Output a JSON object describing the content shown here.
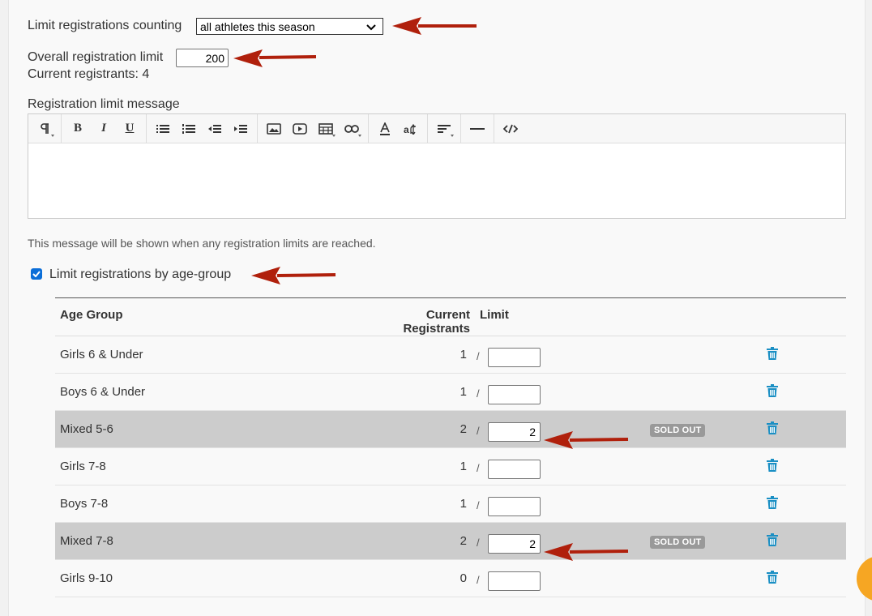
{
  "form": {
    "counting_label": "Limit registrations counting",
    "counting_value": "all athletes this season",
    "overall_label": "Overall registration limit",
    "overall_value": "200",
    "current_registrants": "Current registrants: 4",
    "message_label": "Registration limit message",
    "message_help": "This message will be shown when any registration limits are reached.",
    "agegroup_checkbox_label": "Limit registrations by age-group",
    "agegroup_checked": true
  },
  "editor": {
    "toolbar_icons": [
      "paragraph-format-icon",
      "bold-icon",
      "italic-icon",
      "underline-icon",
      "unordered-list-icon",
      "ordered-list-icon",
      "outdent-icon",
      "indent-icon",
      "insert-image-icon",
      "insert-video-icon",
      "insert-table-icon",
      "insert-link-icon",
      "text-color-icon",
      "font-size-icon",
      "align-icon",
      "horizontal-line-icon",
      "code-view-icon"
    ]
  },
  "table": {
    "headers": {
      "age_group": "Age Group",
      "current_line1": "Current",
      "current_line2": "Registrants",
      "limit": "Limit"
    },
    "slash": "/",
    "rows": [
      {
        "name": "Girls 6 & Under",
        "current": "1",
        "limit": "",
        "sold_out": false
      },
      {
        "name": "Boys 6 & Under",
        "current": "1",
        "limit": "",
        "sold_out": false
      },
      {
        "name": "Mixed 5-6",
        "current": "2",
        "limit": "2",
        "sold_out": true
      },
      {
        "name": "Girls 7-8",
        "current": "1",
        "limit": "",
        "sold_out": false
      },
      {
        "name": "Boys 7-8",
        "current": "1",
        "limit": "",
        "sold_out": false
      },
      {
        "name": "Mixed 7-8",
        "current": "2",
        "limit": "2",
        "sold_out": true
      },
      {
        "name": "Girls 9-10",
        "current": "0",
        "limit": "",
        "sold_out": false
      }
    ],
    "sold_out_label": "SOLD OUT"
  },
  "colors": {
    "accent_blue": "#1a8fc4",
    "annotation_arrow": "#b0200c",
    "soldout_row": "#cccccc",
    "badge_bg": "#999999"
  }
}
